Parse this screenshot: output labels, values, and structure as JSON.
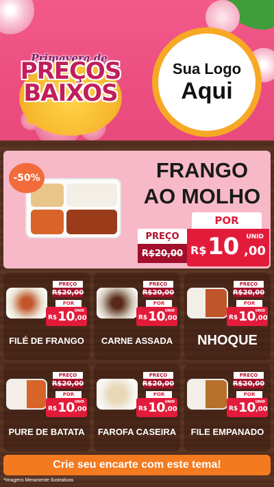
{
  "header": {
    "badge_script": "Primavera de",
    "badge_line1": "PREÇOS",
    "badge_line2": "BAIXOS",
    "logo_line1": "Sua Logo",
    "logo_line2": "Aqui"
  },
  "feature": {
    "discount": "-50%",
    "title_line1": "FRANGO",
    "title_line2": "AO MOLHO",
    "por_label": "POR",
    "preco_label": "PREÇO",
    "old_price": "R$20,00",
    "unit": "UNID",
    "currency": "R$",
    "price_int": "10",
    "price_cents": ",00"
  },
  "cards": [
    {
      "name": "FILÉ DE FRANGO",
      "preco_label": "PREÇO",
      "old_price": "R$20,00",
      "por_label": "POR",
      "unit": "UNID",
      "currency": "R$",
      "price_int": "10",
      "price_cents": ",00"
    },
    {
      "name": "CARNE ASSADA",
      "preco_label": "PREÇO",
      "old_price": "R$20,00",
      "por_label": "POR",
      "unit": "UNID",
      "currency": "R$",
      "price_int": "10",
      "price_cents": ",00"
    },
    {
      "name": "NHOQUE",
      "preco_label": "PREÇO",
      "old_price": "R$20,00",
      "por_label": "POR",
      "unit": "UNID",
      "currency": "R$",
      "price_int": "10",
      "price_cents": ",00"
    },
    {
      "name": "PURE DE BATATA",
      "preco_label": "PREÇO",
      "old_price": "R$20,00",
      "por_label": "POR",
      "unit": "UNID",
      "currency": "R$",
      "price_int": "10",
      "price_cents": ",00"
    },
    {
      "name": "FAROFA CASEIRA",
      "preco_label": "PREÇO",
      "old_price": "R$20,00",
      "por_label": "POR",
      "unit": "UNID",
      "currency": "R$",
      "price_int": "10",
      "price_cents": ",00"
    },
    {
      "name": "FILE EMPANADO",
      "preco_label": "PREÇO",
      "old_price": "R$20,00",
      "por_label": "POR",
      "unit": "UNID",
      "currency": "R$",
      "price_int": "10",
      "price_cents": ",00"
    }
  ],
  "cta": "Crie seu encarte com este tema!",
  "footnote": "*Imagens Meramente Ilustrativas",
  "colors": {
    "header_pink": "#ec4d80",
    "price_red": "#e31b3b",
    "old_price_red": "#a10f2b",
    "cta_orange": "#f47a1f",
    "logo_ring": "#f7a825"
  }
}
